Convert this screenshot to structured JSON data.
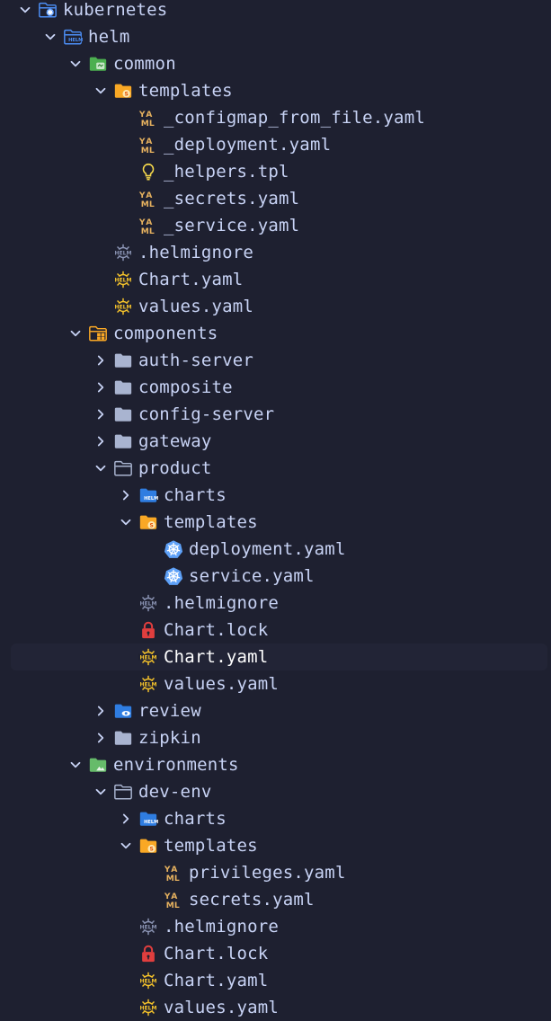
{
  "colors": {
    "background": "#1e2030",
    "text": "#c8d3f5",
    "selected_row": "#222436",
    "chevron": "#c8d3f5",
    "folder": "#a9b4d0",
    "yaml": "#e7b25f",
    "helm": "#f4c22b",
    "helmignore": "#8a93b3",
    "kubernetes": "#5ea1f8",
    "lock": "#e03e3e",
    "bulb": "#f6d94b"
  },
  "tree": [
    {
      "label": "kubernetes",
      "depth": 0,
      "chevron": "down",
      "icon": "folder-kubernetes-open-icon"
    },
    {
      "label": "helm",
      "depth": 1,
      "chevron": "down",
      "icon": "folder-helm-open-icon"
    },
    {
      "label": "common",
      "depth": 2,
      "chevron": "down",
      "icon": "folder-common-open-icon"
    },
    {
      "label": "templates",
      "depth": 3,
      "chevron": "down",
      "icon": "folder-templates-open-icon"
    },
    {
      "label": "_configmap_from_file.yaml",
      "depth": 4,
      "chevron": "none",
      "icon": "yaml-icon"
    },
    {
      "label": "_deployment.yaml",
      "depth": 4,
      "chevron": "none",
      "icon": "yaml-icon"
    },
    {
      "label": "_helpers.tpl",
      "depth": 4,
      "chevron": "none",
      "icon": "lightbulb-icon"
    },
    {
      "label": "_secrets.yaml",
      "depth": 4,
      "chevron": "none",
      "icon": "yaml-icon"
    },
    {
      "label": "_service.yaml",
      "depth": 4,
      "chevron": "none",
      "icon": "yaml-icon"
    },
    {
      "label": ".helmignore",
      "depth": 3,
      "chevron": "none",
      "icon": "helmignore-icon"
    },
    {
      "label": "Chart.yaml",
      "depth": 3,
      "chevron": "none",
      "icon": "helm-icon"
    },
    {
      "label": "values.yaml",
      "depth": 3,
      "chevron": "none",
      "icon": "helm-icon"
    },
    {
      "label": "components",
      "depth": 2,
      "chevron": "down",
      "icon": "folder-components-open-icon"
    },
    {
      "label": "auth-server",
      "depth": 3,
      "chevron": "right",
      "icon": "folder-closed-icon"
    },
    {
      "label": "composite",
      "depth": 3,
      "chevron": "right",
      "icon": "folder-closed-icon"
    },
    {
      "label": "config-server",
      "depth": 3,
      "chevron": "right",
      "icon": "folder-closed-icon"
    },
    {
      "label": "gateway",
      "depth": 3,
      "chevron": "right",
      "icon": "folder-closed-icon"
    },
    {
      "label": "product",
      "depth": 3,
      "chevron": "down",
      "icon": "folder-open-icon"
    },
    {
      "label": "charts",
      "depth": 4,
      "chevron": "right",
      "icon": "folder-helm-icon"
    },
    {
      "label": "templates",
      "depth": 4,
      "chevron": "down",
      "icon": "folder-templates-open-icon"
    },
    {
      "label": "deployment.yaml",
      "depth": 5,
      "chevron": "none",
      "icon": "kubernetes-icon"
    },
    {
      "label": "service.yaml",
      "depth": 5,
      "chevron": "none",
      "icon": "kubernetes-icon"
    },
    {
      "label": ".helmignore",
      "depth": 4,
      "chevron": "none",
      "icon": "helmignore-icon"
    },
    {
      "label": "Chart.lock",
      "depth": 4,
      "chevron": "none",
      "icon": "lock-icon"
    },
    {
      "label": "Chart.yaml",
      "depth": 4,
      "chevron": "none",
      "icon": "helm-icon",
      "selected": true
    },
    {
      "label": "values.yaml",
      "depth": 4,
      "chevron": "none",
      "icon": "helm-icon"
    },
    {
      "label": "review",
      "depth": 3,
      "chevron": "right",
      "icon": "folder-review-icon"
    },
    {
      "label": "zipkin",
      "depth": 3,
      "chevron": "right",
      "icon": "folder-closed-icon"
    },
    {
      "label": "environments",
      "depth": 2,
      "chevron": "down",
      "icon": "folder-environments-open-icon"
    },
    {
      "label": "dev-env",
      "depth": 3,
      "chevron": "down",
      "icon": "folder-open-icon"
    },
    {
      "label": "charts",
      "depth": 4,
      "chevron": "right",
      "icon": "folder-helm-icon"
    },
    {
      "label": "templates",
      "depth": 4,
      "chevron": "down",
      "icon": "folder-templates-open-icon"
    },
    {
      "label": "privileges.yaml",
      "depth": 5,
      "chevron": "none",
      "icon": "yaml-icon"
    },
    {
      "label": "secrets.yaml",
      "depth": 5,
      "chevron": "none",
      "icon": "yaml-icon"
    },
    {
      "label": ".helmignore",
      "depth": 4,
      "chevron": "none",
      "icon": "helmignore-icon"
    },
    {
      "label": "Chart.lock",
      "depth": 4,
      "chevron": "none",
      "icon": "lock-icon"
    },
    {
      "label": "Chart.yaml",
      "depth": 4,
      "chevron": "none",
      "icon": "helm-icon"
    },
    {
      "label": "values.yaml",
      "depth": 4,
      "chevron": "none",
      "icon": "helm-icon"
    }
  ]
}
